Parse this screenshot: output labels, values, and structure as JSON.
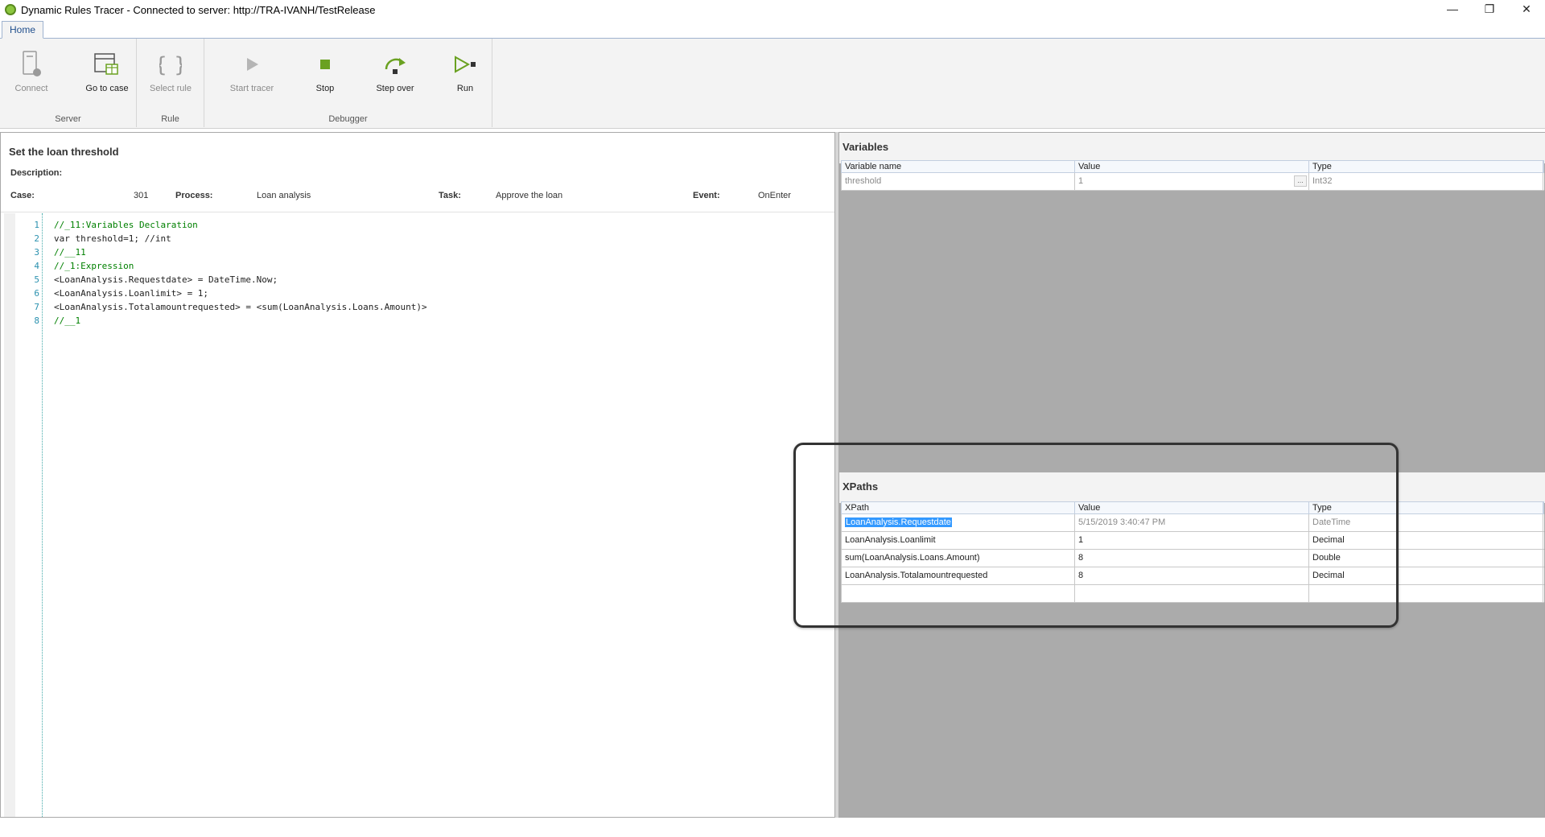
{
  "window": {
    "title": "Dynamic Rules Tracer - Connected to server: http://TRA-IVANH/TestRelease",
    "minimize": "—",
    "restore": "❐",
    "close": "✕"
  },
  "tabs": [
    {
      "label": "Home"
    }
  ],
  "ribbon": {
    "groups": [
      {
        "label": "Server",
        "buttons": [
          {
            "label": "Connect",
            "icon": "connect-icon",
            "enabled": false
          },
          {
            "label": "Go to case",
            "icon": "go-to-case-icon",
            "enabled": true
          }
        ]
      },
      {
        "label": "Rule",
        "buttons": [
          {
            "label": "Select rule",
            "icon": "braces-icon",
            "enabled": false
          }
        ]
      },
      {
        "label": "Debugger",
        "buttons": [
          {
            "label": "Start tracer",
            "icon": "play-icon",
            "enabled": false
          },
          {
            "label": "Stop",
            "icon": "stop-icon",
            "enabled": true
          },
          {
            "label": "Step over",
            "icon": "step-over-icon",
            "enabled": true
          },
          {
            "label": "Run",
            "icon": "run-icon",
            "enabled": true
          }
        ]
      }
    ]
  },
  "rule": {
    "title": "Set the loan threshold",
    "description_label": "Description:",
    "case_label": "Case:",
    "case_value": "301",
    "process_label": "Process:",
    "process_value": "Loan analysis",
    "task_label": "Task:",
    "task_value": "Approve the loan",
    "event_label": "Event:",
    "event_value": "OnEnter"
  },
  "code": {
    "line_numbers": [
      "1",
      "2",
      "3",
      "4",
      "5",
      "6",
      "7",
      "8"
    ],
    "lines": [
      "//_11:Variables Declaration",
      "var threshold=1; //int",
      "//__11",
      "//_1:Expression",
      "<LoanAnalysis.Requestdate> = DateTime.Now;",
      "<LoanAnalysis.Loanlimit> = 1;",
      "<LoanAnalysis.Totalamountrequested> = <sum(LoanAnalysis.Loans.Amount)>",
      "//__1"
    ]
  },
  "variables": {
    "title": "Variables",
    "columns": [
      "Variable name",
      "Value",
      "Type"
    ],
    "rows": [
      {
        "name": "threshold",
        "value": "1",
        "type": "Int32",
        "button": "..."
      }
    ]
  },
  "xpaths": {
    "title": "XPaths",
    "columns": [
      "XPath",
      "Value",
      "Type"
    ],
    "rows": [
      {
        "xpath": "LoanAnalysis.Requestdate",
        "value": "5/15/2019 3:40:47 PM",
        "type": "DateTime"
      },
      {
        "xpath": "LoanAnalysis.Loanlimit",
        "value": "1",
        "type": "Decimal"
      },
      {
        "xpath": "sum(LoanAnalysis.Loans.Amount)",
        "value": "8",
        "type": "Double"
      },
      {
        "xpath": "LoanAnalysis.Totalamountrequested",
        "value": "8",
        "type": "Decimal"
      }
    ]
  },
  "colors": {
    "accent": "#1f4e8c",
    "stop_green": "#6aa121",
    "selection": "#3399ff"
  }
}
